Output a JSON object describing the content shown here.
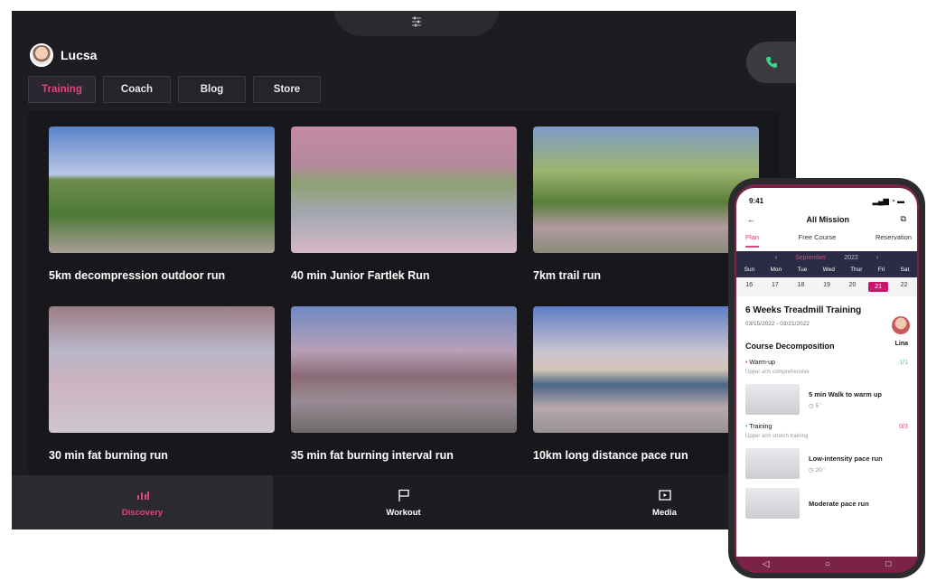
{
  "tablet": {
    "user": {
      "name": "Lucsa"
    },
    "tabs": [
      {
        "label": "Training",
        "active": true
      },
      {
        "label": "Coach",
        "active": false
      },
      {
        "label": "Blog",
        "active": false
      },
      {
        "label": "Store",
        "active": false
      }
    ],
    "cards": [
      {
        "title": "5km decompression outdoor run"
      },
      {
        "title": "40 min Junior Fartlek Run"
      },
      {
        "title": "7km trail run"
      },
      {
        "title": "30 min fat burning run"
      },
      {
        "title": "35 min fat burning interval run"
      },
      {
        "title": "10km long distance pace run"
      }
    ],
    "nav": [
      {
        "label": "Discovery",
        "icon": "discovery-icon",
        "active": true
      },
      {
        "label": "Workout",
        "icon": "flag-icon",
        "active": false
      },
      {
        "label": "Media",
        "icon": "media-icon",
        "active": false
      }
    ],
    "accent_color": "#e0447c"
  },
  "phone": {
    "time": "9:41",
    "header": {
      "title": "All Mission"
    },
    "tabs": [
      {
        "label": "Plan",
        "active": true
      },
      {
        "label": "Free Course",
        "active": false
      },
      {
        "label": "Reservation",
        "active": false
      }
    ],
    "calendar": {
      "month": "September",
      "year": "2022",
      "weekdays": [
        "Sun",
        "Mon",
        "Tue",
        "Wed",
        "Thur",
        "Fri",
        "Sat"
      ],
      "dates": [
        "16",
        "17",
        "18",
        "19",
        "20",
        "21",
        "22"
      ],
      "selected": "21"
    },
    "course": {
      "title": "6 Weeks Treadmill Training",
      "dates": "03/15/2022 - 03/21/2022",
      "coach": "Lina"
    },
    "section_title": "Course Decomposition",
    "phases": [
      {
        "name": "Warm-up",
        "progress": "1/1",
        "subtitle": "Upper arm comprehensive",
        "exercises": [
          {
            "title": "5 min Walk to warm up",
            "duration": "5 '"
          }
        ]
      },
      {
        "name": "Training",
        "progress": "0/3",
        "subtitle": "Upper arm stretch training",
        "exercises": [
          {
            "title": "Low-intensity pace run",
            "duration": "20 '"
          },
          {
            "title": "Moderate pace run",
            "duration": ""
          }
        ]
      }
    ]
  }
}
